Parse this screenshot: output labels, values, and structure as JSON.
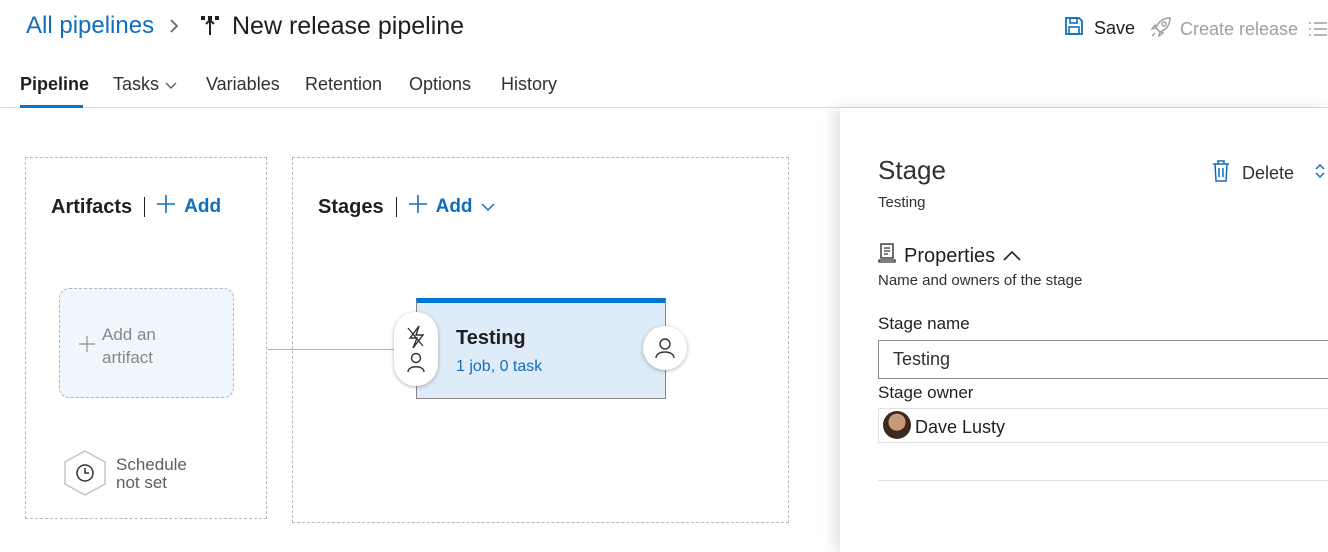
{
  "header": {
    "breadcrumb_root": "All pipelines",
    "pipeline_title": "New release pipeline",
    "save_label": "Save",
    "create_release_label": "Create release"
  },
  "tabs": [
    {
      "label": "Pipeline",
      "active": true
    },
    {
      "label": "Tasks",
      "has_dropdown": true
    },
    {
      "label": "Variables"
    },
    {
      "label": "Retention"
    },
    {
      "label": "Options"
    },
    {
      "label": "History"
    }
  ],
  "artifacts": {
    "heading": "Artifacts",
    "add_label": "Add",
    "add_artifact_line1": "Add an",
    "add_artifact_line2": "artifact",
    "schedule_line1": "Schedule",
    "schedule_line2": "not set"
  },
  "stages": {
    "heading": "Stages",
    "add_label": "Add",
    "items": [
      {
        "name": "Testing",
        "summary": "1 job, 0 task"
      }
    ]
  },
  "panel": {
    "title": "Stage",
    "subtitle": "Testing",
    "delete_label": "Delete",
    "properties_heading": "Properties",
    "properties_desc": "Name and owners of the stage",
    "stage_name_label": "Stage name",
    "stage_name_value": "Testing",
    "stage_owner_label": "Stage owner",
    "stage_owner_value": "Dave Lusty"
  },
  "colors": {
    "accent": "#0078d4",
    "link": "#106ebe",
    "stage_card_bg": "#deecf9",
    "artifact_bg": "#eff6fc"
  },
  "icons": [
    "chevron-right-icon",
    "pipeline-icon",
    "save-icon",
    "rocket-icon",
    "list-icon",
    "chevron-down-icon",
    "plus-icon",
    "clock-icon",
    "lightning-icon",
    "person-icon",
    "trash-icon",
    "updown-icon",
    "properties-icon",
    "chevron-up-icon"
  ]
}
